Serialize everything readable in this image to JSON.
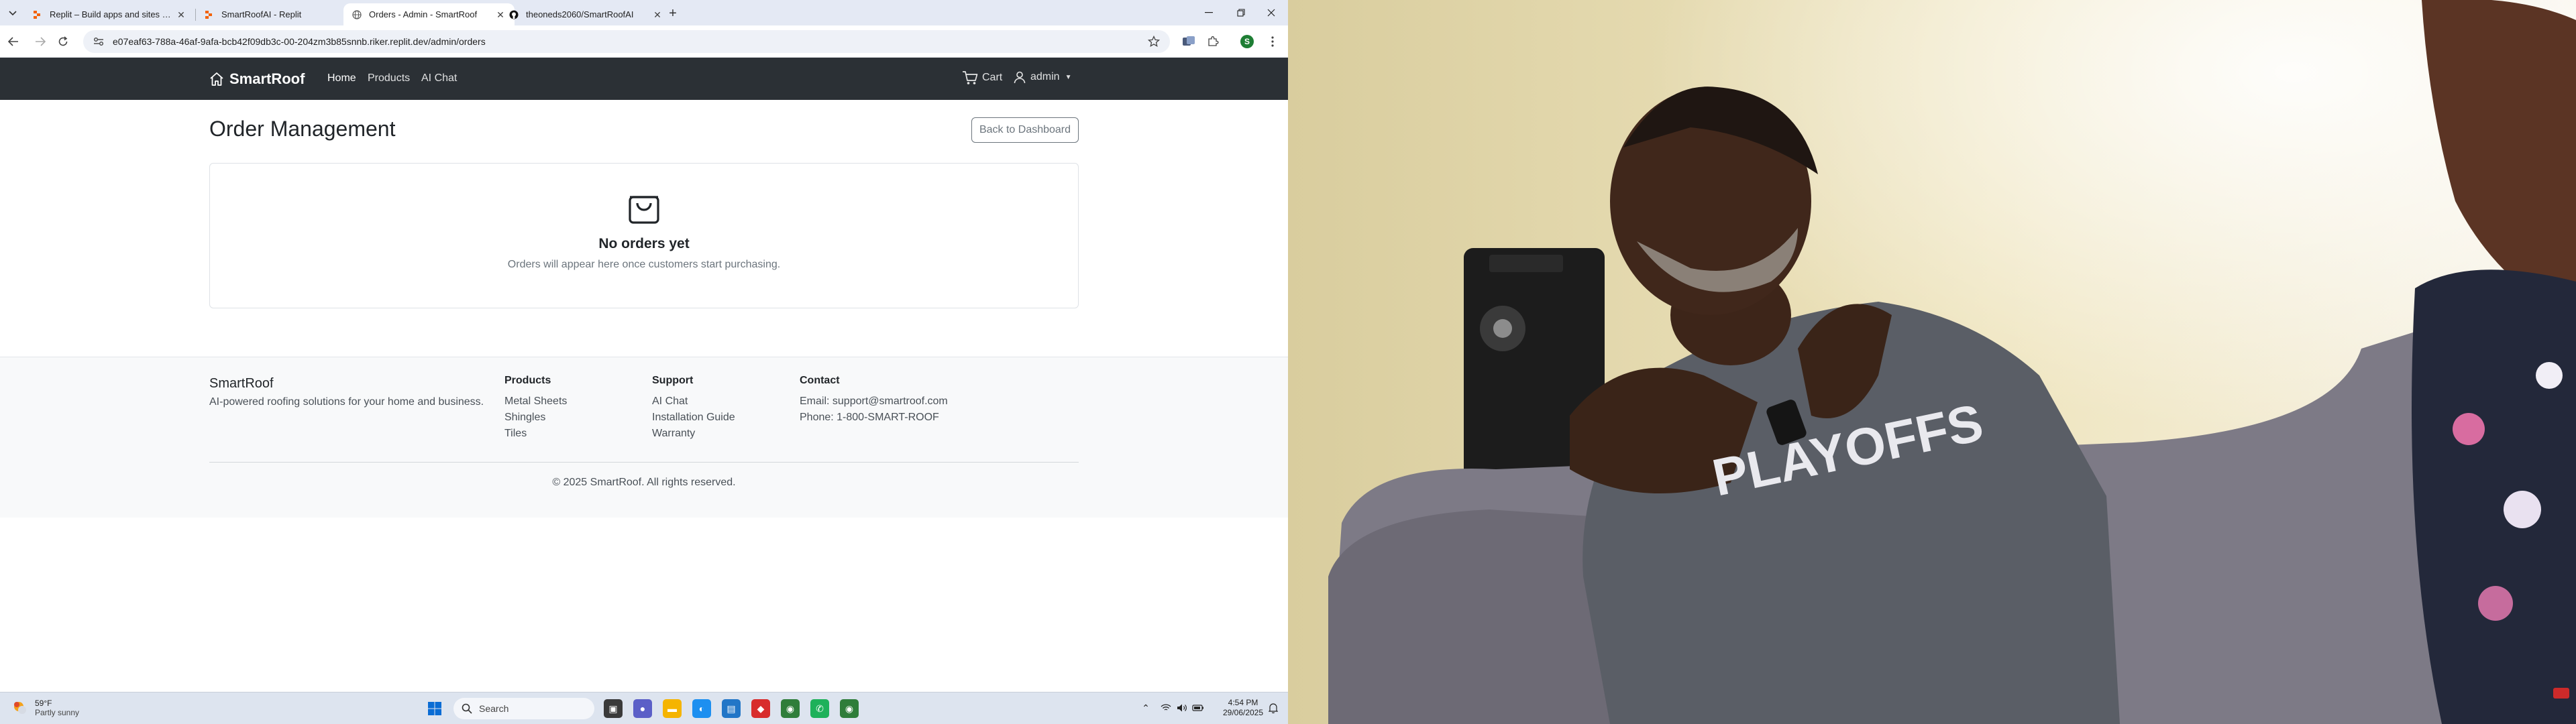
{
  "browser": {
    "tabs": [
      {
        "title": "Replit – Build apps and sites with AI",
        "active": false,
        "favicon": "replit-icon"
      },
      {
        "title": "SmartRoofAI - Replit",
        "active": false,
        "favicon": "replit-icon"
      },
      {
        "title": "Orders - Admin - SmartRoof",
        "active": true,
        "favicon": "globe-icon"
      },
      {
        "title": "theoneds2060/SmartRoofAI",
        "active": false,
        "favicon": "github-icon"
      }
    ],
    "url": "e07eaf63-788a-46af-9afa-bcb42f09db3c-00-204zm3b85snnb.riker.replit.dev/admin/orders",
    "profile_initial": "S"
  },
  "site": {
    "brand": "SmartRoof",
    "nav": {
      "home": "Home",
      "products": "Products",
      "ai_chat": "AI Chat"
    },
    "cart": "Cart",
    "user": "admin"
  },
  "main": {
    "title": "Order Management",
    "back_button": "Back to Dashboard",
    "empty_title": "No orders yet",
    "empty_message": "Orders will appear here once customers start purchasing."
  },
  "footer": {
    "brand": "SmartRoof",
    "tagline": "AI-powered roofing solutions for your home and business.",
    "columns": [
      {
        "heading": "Products",
        "items": [
          "Metal Sheets",
          "Shingles",
          "Tiles"
        ]
      },
      {
        "heading": "Support",
        "items": [
          "AI Chat",
          "Installation Guide",
          "Warranty"
        ]
      },
      {
        "heading": "Contact",
        "items": [
          "Email: support@smartroof.com",
          "Phone: 1-800-SMART-ROOF"
        ]
      }
    ],
    "copyright": "© 2025 SmartRoof. All rights reserved."
  },
  "taskbar": {
    "weather_temp": "59°F",
    "weather_condition": "Partly sunny",
    "search_placeholder": "Search",
    "time": "4:54 PM",
    "date": "29/06/2025"
  },
  "colors": {
    "navbar_bg": "#2b3035",
    "tabstrip_bg": "#e4e9f4",
    "footer_bg": "#f8f9fa",
    "secondary": "#6c757d"
  }
}
